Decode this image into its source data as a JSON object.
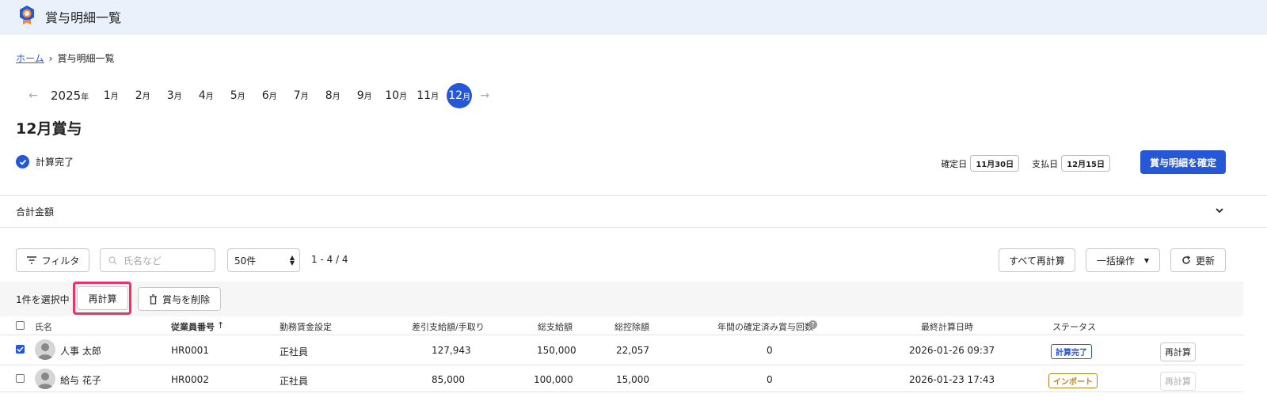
{
  "header": {
    "title": "賞与明細一覧",
    "logo_icon": "medal-icon"
  },
  "breadcrumb": {
    "home": "ホーム",
    "current": "賞与明細一覧"
  },
  "month_nav": {
    "year": "2025",
    "year_unit": "年",
    "month_unit": "月",
    "months": [
      "1",
      "2",
      "3",
      "4",
      "5",
      "6",
      "7",
      "8",
      "9",
      "10",
      "11",
      "12"
    ],
    "active_month": "12"
  },
  "page_title": "12月賞与",
  "status": {
    "label": "計算完了"
  },
  "dates": {
    "confirm_label": "確定日",
    "confirm_value": "11月30日",
    "pay_label": "支払日",
    "pay_value": "12月15日"
  },
  "confirm_button": "賞与明細を確定",
  "total": {
    "label": "合計金額"
  },
  "toolbar": {
    "filter": "フィルタ",
    "search_placeholder": "氏名など",
    "per_page": "50件",
    "count": "1 - 4 / 4",
    "recalc_all": "すべて再計算",
    "bulk": "一括操作",
    "refresh": "更新"
  },
  "selection": {
    "selected_text": "1件を選択中",
    "recalc": "再計算",
    "delete": "賞与を削除"
  },
  "table": {
    "headers": {
      "name": "氏名",
      "emp_no": "従業員番号",
      "wage": "勤務賃金設定",
      "net": "差引支給額/手取り",
      "gross": "総支給額",
      "deduct": "総控除額",
      "annual": "年間の確定済み賞与回数",
      "last_calc": "最終計算日時",
      "status": "ステータス"
    },
    "rows": [
      {
        "name": "人事 太郎",
        "emp_no": "HR0001",
        "wage": "正社員",
        "net": "127,943",
        "gross": "150,000",
        "deduct": "22,057",
        "annual": "0",
        "last_calc": "2026-01-26 09:37",
        "status": "計算完了",
        "action": "再計算"
      },
      {
        "name": "給与 花子",
        "emp_no": "HR0002",
        "wage": "正社員",
        "net": "85,000",
        "gross": "100,000",
        "deduct": "15,000",
        "annual": "0",
        "last_calc": "2026-01-23 17:43",
        "status": "インポート",
        "action": "再計算"
      }
    ]
  },
  "colors": {
    "primary": "#2557d6",
    "highlight": "#f0306a",
    "header_bg": "#eaf1fb",
    "import_badge": "#c0821e"
  }
}
